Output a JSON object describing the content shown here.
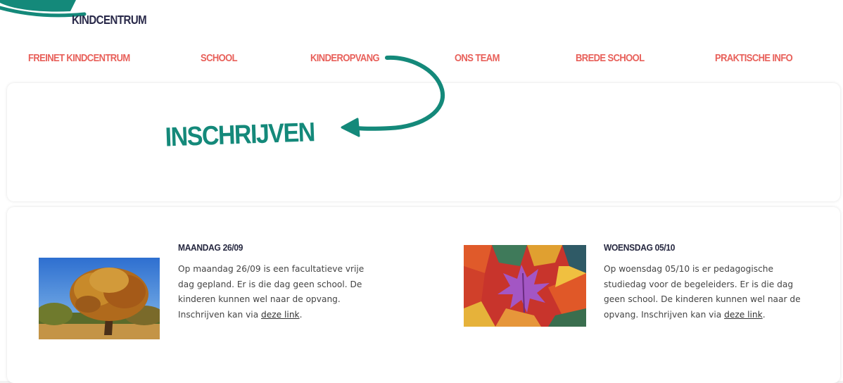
{
  "logo": {
    "text": "KINDCENTRUM"
  },
  "nav": {
    "items": [
      {
        "label": "FREINET KINDCENTRUM"
      },
      {
        "label": "SCHOOL"
      },
      {
        "label": "KINDEROPVANG"
      },
      {
        "label": "ONS TEAM"
      },
      {
        "label": "BREDE SCHOOL"
      },
      {
        "label": "PRAKTISCHE INFO"
      }
    ]
  },
  "hero": {
    "cta": "INSCHRIJVEN"
  },
  "news": [
    {
      "title": "MAANDAG 26/09",
      "body": "Op maandag 26/09 is een facultatieve vrije dag gepland. Er is die dag geen school. De kinderen kunnen wel naar de opvang. Inschrijven kan via",
      "link": "deze link",
      "image": "autumn-tree"
    },
    {
      "title": "WOENSDAG 05/10",
      "body": "Op woensdag 05/10 is er pedagogische studiedag voor de begeleiders. Er is die dag geen school. De kinderen kunnen wel naar de opvang. Inschrijven kan via",
      "link": "deze link",
      "image": "autumn-leaves"
    }
  ],
  "colors": {
    "teal": "#14897a",
    "coral": "#e8605a",
    "navy": "#262840"
  }
}
